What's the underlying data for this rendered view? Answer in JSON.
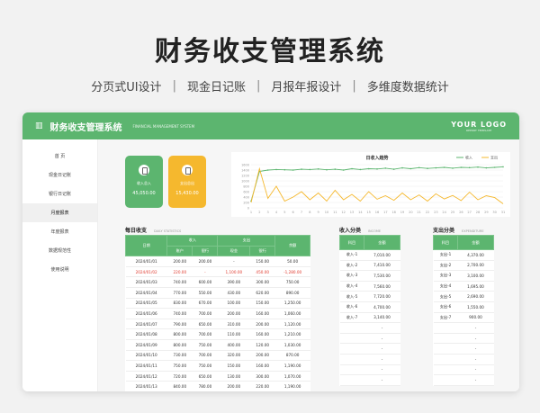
{
  "header": {
    "title": "财务收支管理系统",
    "features": [
      "分页式UI设计",
      "现金日记账",
      "月报年报设计",
      "多维度数据统计"
    ]
  },
  "app": {
    "title": "财务收支管理系统",
    "subtitle": "FINANCIAL MANAGEMENT SYSTEM",
    "logo": "YOUR LOGO",
    "logo_sub": "REPORT TEMPLATE"
  },
  "sidebar": {
    "items": [
      "首 页",
      "现金日记账",
      "银行日记账",
      "月度报表",
      "年度报表",
      "数据规范性",
      "使用说明"
    ],
    "active": 3
  },
  "kpis": [
    {
      "label": "收入总入",
      "value": "45,050.00",
      "color": "#5cb56f"
    },
    {
      "label": "支出总出",
      "value": "15,430.00",
      "color": "#f5b82e"
    }
  ],
  "chart_data": {
    "type": "line",
    "title": "日收入趋势",
    "legend": [
      "收入",
      "支出"
    ],
    "x": [
      1,
      2,
      3,
      4,
      5,
      6,
      7,
      8,
      9,
      10,
      11,
      12,
      13,
      14,
      15,
      16,
      17,
      18,
      19,
      20,
      21,
      22,
      23,
      24,
      25,
      26,
      27,
      28,
      29,
      30,
      31
    ],
    "series": [
      {
        "name": "收入",
        "color": "#5cb56f",
        "values": [
          250,
          1350,
          1400,
          1420,
          1410,
          1400,
          1430,
          1420,
          1440,
          1410,
          1430,
          1400,
          1450,
          1420,
          1450,
          1440,
          1470,
          1430,
          1480,
          1450,
          1490,
          1460,
          1480,
          1500,
          1470,
          1500,
          1490,
          1510,
          1480,
          1500,
          1520
        ]
      },
      {
        "name": "支出",
        "color": "#f5b82e",
        "values": [
          200,
          1450,
          350,
          800,
          250,
          400,
          600,
          300,
          550,
          250,
          650,
          300,
          500,
          250,
          600,
          320,
          450,
          280,
          550,
          300,
          480,
          250,
          520,
          330,
          460,
          270,
          580,
          300,
          450,
          380,
          150
        ]
      }
    ],
    "ylim": [
      0,
      1600
    ],
    "yticks": [
      0,
      200,
      400,
      600,
      800,
      1000,
      1200,
      1400,
      1600
    ]
  },
  "daily": {
    "title": "每日收支",
    "subtitle": "DAILY STATISTICS",
    "headers": [
      "日期",
      "收入",
      "支出",
      "余额"
    ],
    "sub_headers": [
      "账户",
      "现金",
      "银行",
      "现金",
      "银行"
    ],
    "rows": [
      [
        "2024/01/01",
        "200.00",
        "200.00",
        "-",
        "150.00",
        "200.00",
        "50.00"
      ],
      [
        "2024/01/02",
        "220.00",
        "-",
        "1,100.00",
        "450.00",
        "-1,280.00"
      ],
      [
        "2024/01/03",
        "740.00",
        "600.00",
        "390.00",
        "300.00",
        "750.00"
      ],
      [
        "2024/01/04",
        "770.00",
        "550.00",
        "430.00",
        "620.00",
        "890.00"
      ],
      [
        "2024/01/05",
        "830.00",
        "670.00",
        "100.00",
        "150.00",
        "1,250.00"
      ],
      [
        "2024/01/06",
        "740.00",
        "700.00",
        "200.00",
        "160.00",
        "1,060.00"
      ],
      [
        "2024/01/07",
        "790.00",
        "650.00",
        "310.00",
        "200.00",
        "1,120.00"
      ],
      [
        "2024/01/08",
        "800.00",
        "700.00",
        "110.00",
        "160.00",
        "1,210.00"
      ],
      [
        "2024/01/09",
        "800.00",
        "750.00",
        "400.00",
        "120.00",
        "1,030.00"
      ],
      [
        "2024/01/10",
        "730.00",
        "700.00",
        "320.00",
        "200.00",
        "870.00"
      ],
      [
        "2024/01/11",
        "750.00",
        "750.00",
        "150.00",
        "160.00",
        "1,190.00"
      ],
      [
        "2024/01/12",
        "720.00",
        "650.00",
        "130.00",
        "300.00",
        "1,070.00"
      ],
      [
        "2024/01/13",
        "840.00",
        "780.00",
        "200.00",
        "220.00",
        "1,190.00"
      ]
    ]
  },
  "income": {
    "title": "收入分类",
    "subtitle": "INCOME",
    "headers": [
      "科目",
      "金额"
    ],
    "rows": [
      [
        "收入-1",
        "7,010.00"
      ],
      [
        "收入-2",
        "7,410.00"
      ],
      [
        "收入-3",
        "7,530.00"
      ],
      [
        "收入-4",
        "7,560.00"
      ],
      [
        "收入-5",
        "7,720.00"
      ],
      [
        "收入-6",
        "4,700.00"
      ],
      [
        "收入-7",
        "3,140.00"
      ],
      [
        "",
        "-"
      ],
      [
        "",
        "-"
      ],
      [
        "",
        "-"
      ],
      [
        "",
        "-"
      ],
      [
        "",
        "-"
      ],
      [
        "",
        "-"
      ]
    ]
  },
  "expense": {
    "title": "支出分类",
    "subtitle": "EXPENDITURE",
    "headers": [
      "科目",
      "金额"
    ],
    "rows": [
      [
        "支出-1",
        "4,370.00"
      ],
      [
        "支出-2",
        "2,700.00"
      ],
      [
        "支出-3",
        "3,100.00"
      ],
      [
        "支出-4",
        "1,695.00"
      ],
      [
        "支出-5",
        "2,690.00"
      ],
      [
        "支出-6",
        "1,550.00"
      ],
      [
        "支出-7",
        "900.00"
      ],
      [
        "",
        "-"
      ],
      [
        "",
        "-"
      ],
      [
        "",
        "-"
      ],
      [
        "",
        "-"
      ],
      [
        "",
        "-"
      ],
      [
        "",
        "-"
      ]
    ]
  }
}
